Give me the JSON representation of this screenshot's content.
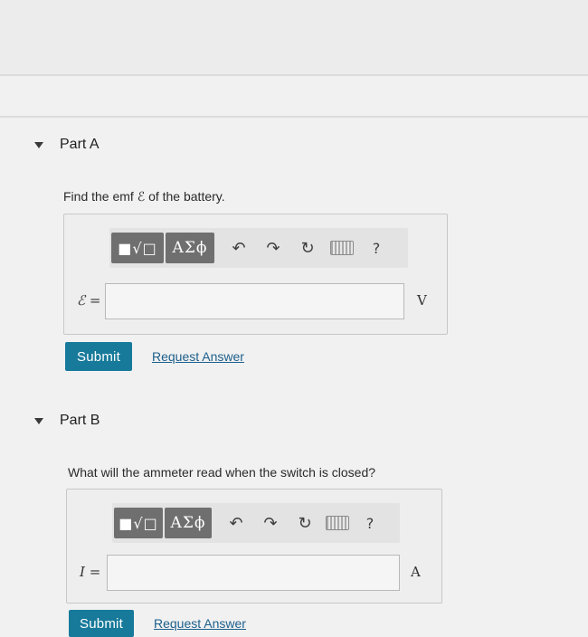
{
  "parts": [
    {
      "title": "Part A",
      "question": "Find the emf ℰ of the battery.",
      "toolbar": {
        "templates_icon": "■√□",
        "symbols_label": "ΑΣϕ",
        "undo_icon": "↶",
        "redo_icon": "↷",
        "reset_icon": "↻",
        "keyboard_icon": "keyboard",
        "help_label": "?"
      },
      "input": {
        "label": "ℰ =",
        "value": "",
        "unit": "V"
      },
      "submit_label": "Submit",
      "request_answer_label": "Request Answer"
    },
    {
      "title": "Part B",
      "question": "What will the ammeter read when the switch is closed?",
      "toolbar": {
        "templates_icon": "■√□",
        "symbols_label": "ΑΣϕ",
        "undo_icon": "↶",
        "redo_icon": "↷",
        "reset_icon": "↻",
        "keyboard_icon": "keyboard",
        "help_label": "?"
      },
      "input": {
        "label": "I =",
        "value": "",
        "unit": "A"
      },
      "submit_label": "Submit",
      "request_answer_label": "Request Answer"
    }
  ]
}
